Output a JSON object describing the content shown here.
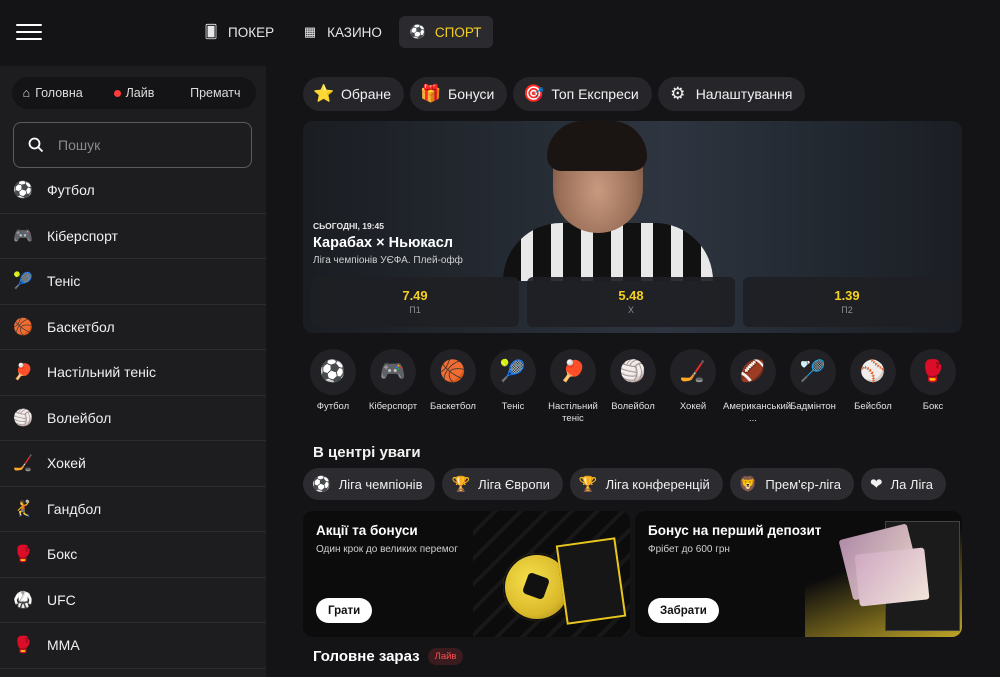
{
  "topnav": {
    "tabs": [
      {
        "label": "ПОКЕР",
        "icon": "poker-icon",
        "active": false
      },
      {
        "label": "КАЗИНО",
        "icon": "slot-machine-icon",
        "active": false
      },
      {
        "label": "СПОРТ",
        "icon": "sport-ball-icon",
        "active": true
      }
    ]
  },
  "sidebar": {
    "segments": [
      {
        "label": "Головна",
        "icon": "home-icon"
      },
      {
        "label": "Лайв",
        "icon": "live-dot-icon"
      },
      {
        "label": "Прематч",
        "icon": ""
      }
    ],
    "search_placeholder": "Пошук",
    "sports": [
      {
        "label": "Футбол",
        "glyph": "⚽"
      },
      {
        "label": "Кіберспорт",
        "glyph": "🎮"
      },
      {
        "label": "Теніс",
        "glyph": "🎾"
      },
      {
        "label": "Баскетбол",
        "glyph": "🏀"
      },
      {
        "label": "Настільний теніс",
        "glyph": "🏓"
      },
      {
        "label": "Волейбол",
        "glyph": "🏐"
      },
      {
        "label": "Хокей",
        "glyph": "🏒"
      },
      {
        "label": "Гандбол",
        "glyph": "🤾"
      },
      {
        "label": "Бокс",
        "glyph": "🥊"
      },
      {
        "label": "UFC",
        "glyph": "🥋"
      },
      {
        "label": "MMA",
        "glyph": "🥊"
      }
    ]
  },
  "quick_chips": [
    {
      "label": "Обране",
      "glyph": "⭐"
    },
    {
      "label": "Бонуси",
      "glyph": "🎁"
    },
    {
      "label": "Топ Експреси",
      "glyph": "🎯"
    },
    {
      "label": "Налаштування",
      "glyph": "⚙"
    }
  ],
  "hero": {
    "time": "СЬОГОДНІ, 19:45",
    "title": "Карабах × Ньюкасл",
    "league": "Ліга чемпіонів УЄФА. Плей-офф",
    "odds": [
      {
        "value": "7.49",
        "label": "П1"
      },
      {
        "value": "5.48",
        "label": "Х"
      },
      {
        "value": "1.39",
        "label": "П2"
      }
    ]
  },
  "categories": [
    {
      "label": "Футбол",
      "glyph": "⚽"
    },
    {
      "label": "Кіберспорт",
      "glyph": "🎮"
    },
    {
      "label": "Баскетбол",
      "glyph": "🏀"
    },
    {
      "label": "Теніс",
      "glyph": "🎾"
    },
    {
      "label": "Настільний теніс",
      "glyph": "🏓"
    },
    {
      "label": "Волейбол",
      "glyph": "🏐"
    },
    {
      "label": "Хокей",
      "glyph": "🏒"
    },
    {
      "label": "Американський ...",
      "glyph": "🏈"
    },
    {
      "label": "Бадмінтон",
      "glyph": "🏸"
    },
    {
      "label": "Бейсбол",
      "glyph": "⚾"
    },
    {
      "label": "Бокс",
      "glyph": "🥊"
    }
  ],
  "focus": {
    "title": "В центрі уваги",
    "leagues": [
      {
        "label": "Ліга чемпіонів",
        "glyph": "⚽"
      },
      {
        "label": "Ліга Європи",
        "glyph": "🏆"
      },
      {
        "label": "Ліга конференцій",
        "glyph": "🏆"
      },
      {
        "label": "Прем'єр-ліга",
        "glyph": "🦁"
      },
      {
        "label": "Ла Ліга",
        "glyph": "❤"
      }
    ]
  },
  "promos": [
    {
      "title": "Акції та бонуси",
      "subtitle": "Один крок до великих перемог",
      "button": "Грати"
    },
    {
      "title": "Бонус на перший депозит",
      "subtitle": "Фрібет до 600 грн",
      "button": "Забрати"
    }
  ],
  "main_now": {
    "title": "Головне зараз",
    "badge": "Лайв"
  },
  "colors": {
    "accent": "#f5d020",
    "live": "#ff3b3b",
    "bg": "#141416",
    "panel": "#1d1d20"
  }
}
